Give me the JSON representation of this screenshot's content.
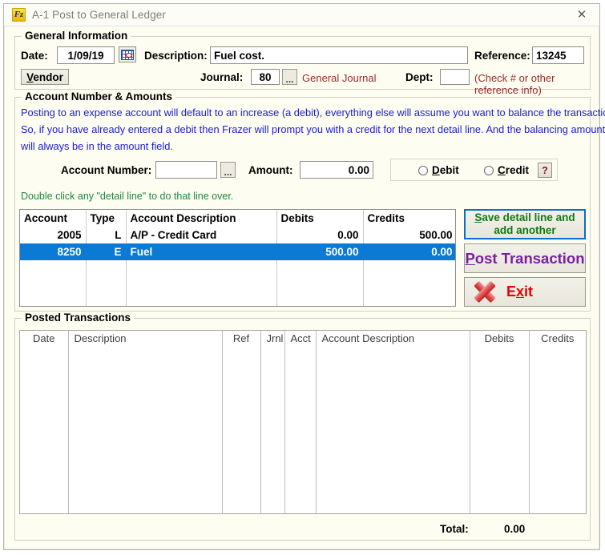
{
  "window": {
    "title": "A-1  Post to General Ledger",
    "icon": "frazer-logo-icon",
    "icon_text": "Fz",
    "close_label": "✕"
  },
  "general_information": {
    "legend": "General Information",
    "date_label": "Date:",
    "date_value": "1/09/19",
    "calendar_icon": "calendar-icon",
    "description_label": "Description:",
    "description_value": "Fuel cost.",
    "reference_label": "Reference:",
    "reference_value": "13245",
    "vendor_button": "Vendor",
    "journal_label": "Journal:",
    "journal_value": "80",
    "journal_browse": "...",
    "journal_name": "General Journal",
    "dept_label": "Dept:",
    "dept_value": "",
    "reference_hint": "(Check # or other reference info)"
  },
  "account_amounts": {
    "legend": "Account Number & Amounts",
    "info_line_1": "Posting to an expense account will default to an increase (a debit), everything else will assume you want to balance the transaction.",
    "info_line_2": "So, if you have already entered a debit then Frazer will prompt you with a credit for the next detail line.  And the balancing amount",
    "info_line_3": "will always be in the amount field.",
    "account_number_label": "Account Number:",
    "account_number_value": "",
    "account_browse": "...",
    "amount_label": "Amount:",
    "amount_value": "0.00",
    "debit_label": "Debit",
    "credit_label": "Credit",
    "help_label": "?",
    "debit_selected": false,
    "credit_selected": false
  },
  "detail": {
    "hint": "Double click any \"detail line\" to do that line over.",
    "columns": [
      "Account",
      "Type",
      "Account Description",
      "Debits",
      "Credits"
    ],
    "rows": [
      {
        "account": "2005",
        "type": "L",
        "description": "A/P - Credit Card",
        "debits": "0.00",
        "credits": "500.00",
        "selected": false
      },
      {
        "account": "8250",
        "type": "E",
        "description": "Fuel",
        "debits": "500.00",
        "credits": "0.00",
        "selected": true
      }
    ],
    "blank_rows": 3
  },
  "actions": {
    "save_line": "Save detail line and add another",
    "post_transaction": "Post Transaction",
    "exit": "Exit",
    "exit_icon": "red-x-icon"
  },
  "posted_transactions": {
    "legend": "Posted Transactions",
    "columns": [
      "Date",
      "Description",
      "Ref",
      "Jrnl",
      "Acct",
      "Account Description",
      "Debits",
      "Credits"
    ],
    "rows": [],
    "total_label": "Total:",
    "total_value": "0.00"
  },
  "colors": {
    "accent_selection": "#0a7ad4",
    "info_blue": "#1b1bd8",
    "hint_green": "#1a8a3a",
    "label_red": "#9e2a2b",
    "save_green": "#0e7a14",
    "post_purple": "#7a1fa2",
    "exit_red": "#e60000",
    "window_bg": "#fdfdf2"
  }
}
